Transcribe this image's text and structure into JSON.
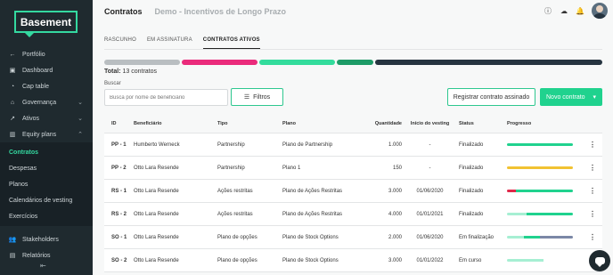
{
  "brand": {
    "logo_text": "Basement"
  },
  "sidebar": {
    "items": [
      {
        "label": "Portfólio",
        "icon": "arrow-left-icon"
      },
      {
        "label": "Dashboard",
        "icon": "dashboard-icon"
      },
      {
        "label": "Cap table",
        "icon": "pie-chart-icon"
      },
      {
        "label": "Governança",
        "icon": "bank-icon"
      },
      {
        "label": "Ativos",
        "icon": "trend-icon"
      },
      {
        "label": "Equity plans",
        "icon": "chart-icon"
      }
    ],
    "subitems": [
      {
        "label": "Contratos",
        "active": true
      },
      {
        "label": "Despesas"
      },
      {
        "label": "Planos"
      },
      {
        "label": "Calendários de vesting"
      },
      {
        "label": "Exercícios"
      }
    ],
    "bottom_items": [
      {
        "label": "Stakeholders",
        "icon": "users-icon"
      },
      {
        "label": "Relatórios",
        "icon": "report-icon"
      }
    ],
    "collapse_glyph": "⇤"
  },
  "header": {
    "title": "Contratos",
    "company": "Demo - Incentivos de Longo Prazo"
  },
  "tabs": [
    "RASCUNHO",
    "EM ASSINATURA",
    "CONTRATOS ATIVOS"
  ],
  "summary": {
    "total_label": "Total:",
    "total_value": "13 contratos",
    "segments": [
      {
        "color": "#b9bec1",
        "flex": 85
      },
      {
        "color": "#ea2b7b",
        "flex": 85
      },
      {
        "color": "#33dc9c",
        "flex": 85
      },
      {
        "color": "#1d9b67",
        "flex": 42
      },
      {
        "color": "#263440",
        "flex": 255
      }
    ]
  },
  "search": {
    "label": "Buscar",
    "placeholder": "Busca por nome de beneficiário"
  },
  "buttons": {
    "filters": "Filtros",
    "register": "Registrar contrato assinado",
    "new": "Novo contrato"
  },
  "table": {
    "headers": [
      "ID",
      "Beneficiário",
      "Tipo",
      "Plano",
      "Quantidade",
      "Início do vesting",
      "Status",
      "Progresso"
    ],
    "rows": [
      {
        "id": "PP - 1",
        "ben": "Humberto Werneck",
        "tipo": "Partnership",
        "plano": "Plano de Partnership",
        "qtd": "1.000",
        "ini": "-",
        "status": "Finalizado",
        "prog": [
          {
            "c": "#20d28e",
            "f": 1
          }
        ]
      },
      {
        "id": "PP - 2",
        "ben": "Otto Lara Resende",
        "tipo": "Partnership",
        "plano": "Plano 1",
        "qtd": "150",
        "ini": "-",
        "status": "Finalizado",
        "prog": [
          {
            "c": "#f1c232",
            "f": 1
          }
        ]
      },
      {
        "id": "RS - 1",
        "ben": "Otto Lara Resende",
        "tipo": "Ações restritas",
        "plano": "Plano de Ações Restritas",
        "qtd": "3.000",
        "ini": "01/06/2020",
        "status": "Finalizado",
        "prog": [
          {
            "c": "#e0284a",
            "f": 0.14
          },
          {
            "c": "#20d28e",
            "f": 0.86
          }
        ]
      },
      {
        "id": "RS - 2",
        "ben": "Otto Lara Resende",
        "tipo": "Ações restritas",
        "plano": "Plano de Ações Restritas",
        "qtd": "4.000",
        "ini": "01/01/2021",
        "status": "Finalizado",
        "prog": [
          {
            "c": "#a6efd3",
            "f": 0.3
          },
          {
            "c": "#20d28e",
            "f": 0.7
          }
        ]
      },
      {
        "id": "SO - 1",
        "ben": "Otto Lara Resende",
        "tipo": "Plano de opções",
        "plano": "Plano de Stock Options",
        "qtd": "2.000",
        "ini": "01/06/2020",
        "status": "Em finalização",
        "prog": [
          {
            "c": "#a6efd3",
            "f": 0.25
          },
          {
            "c": "#20d28e",
            "f": 0.25
          },
          {
            "c": "#7b87a6",
            "f": 0.5
          }
        ]
      },
      {
        "id": "SO - 2",
        "ben": "Otto Lara Resende",
        "tipo": "Plano de opções",
        "plano": "Plano de Stock Options",
        "qtd": "3.000",
        "ini": "01/01/2022",
        "status": "Em curso",
        "prog": [
          {
            "c": "#a6efd3",
            "f": 0.55
          },
          {
            "c": "#ffffff",
            "f": 0.45
          }
        ]
      }
    ]
  }
}
